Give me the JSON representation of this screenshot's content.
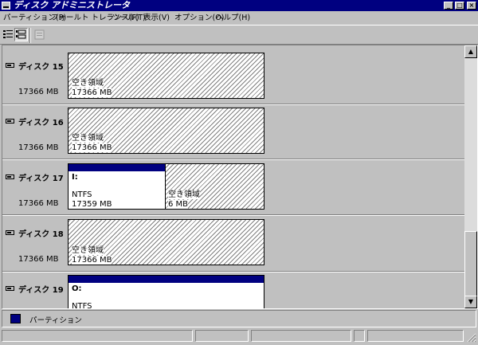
{
  "window": {
    "title": "ディスク アドミニストレータ",
    "buttons": {
      "minimize": "_",
      "maximize": "□",
      "close": "×"
    }
  },
  "menu": {
    "items": [
      {
        "label": "パーティション(P)"
      },
      {
        "label": "フォールト トレランス(F)"
      },
      {
        "label": "ツール(T)"
      },
      {
        "label": "表示(V)"
      },
      {
        "label": "オプション(O)"
      },
      {
        "label": "ヘルプ(H)"
      }
    ]
  },
  "toolbar": {
    "buttons": [
      {
        "icon": "volume-view-icon",
        "pressed": false
      },
      {
        "icon": "disk-configuration-view-icon",
        "pressed": true
      },
      {
        "icon": "properties-icon",
        "disabled": true
      }
    ]
  },
  "disks": [
    {
      "name": "ディスク 15",
      "size": "17366 MB",
      "regions": [
        {
          "type": "free",
          "label": "空き領域",
          "size": "17366 MB"
        }
      ]
    },
    {
      "name": "ディスク 16",
      "size": "17366 MB",
      "regions": [
        {
          "type": "free",
          "label": "空き領域",
          "size": "17366 MB"
        }
      ]
    },
    {
      "name": "ディスク 17",
      "size": "17366 MB",
      "regions": [
        {
          "type": "partition",
          "drive": "I:",
          "fs": "NTFS",
          "size": "17359 MB"
        },
        {
          "type": "free",
          "label": "空き領域",
          "size": "6 MB"
        }
      ]
    },
    {
      "name": "ディスク 18",
      "size": "17366 MB",
      "regions": [
        {
          "type": "free",
          "label": "空き領域",
          "size": "17366 MB"
        }
      ]
    },
    {
      "name": "ディスク 19",
      "size": "",
      "regions": [
        {
          "type": "partition",
          "drive": "O:",
          "fs": "NTFS",
          "size": ""
        }
      ]
    }
  ],
  "legend": {
    "partition_label": "パーティション",
    "partition_color": "#000080"
  },
  "colors": {
    "titlebar": "#000080",
    "face": "#c0c0c0",
    "partition_header": "#000080"
  }
}
